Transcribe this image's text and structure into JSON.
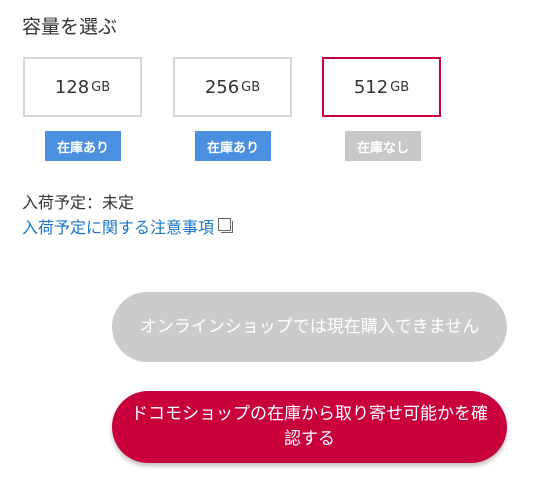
{
  "section_title": "容量を選ぶ",
  "options": [
    {
      "value": "128",
      "unit": "GB",
      "stock": "在庫あり",
      "selected": false,
      "available": true
    },
    {
      "value": "256",
      "unit": "GB",
      "stock": "在庫あり",
      "selected": false,
      "available": true
    },
    {
      "value": "512",
      "unit": "GB",
      "stock": "在庫なし",
      "selected": true,
      "available": false
    }
  ],
  "arrival_text": "入荷予定：未定",
  "notice_link": "入荷予定に関する注意事項",
  "buttons": {
    "online_disabled": "オンラインショップでは現在購入できません",
    "check_store": "ドコモショップの在庫から取り寄せ可能かを確認する"
  },
  "colors": {
    "accent": "#c8003c",
    "in_stock": "#4a8fe0",
    "out_of_stock": "#c8c8c8",
    "link": "#1a77c9"
  }
}
